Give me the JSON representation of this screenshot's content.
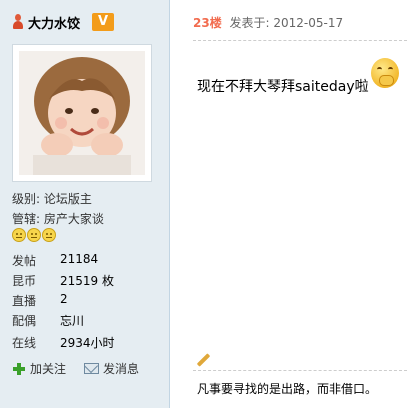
{
  "author": {
    "name": "大力水饺",
    "badge": "V"
  },
  "profile": {
    "rank_label": "级别:",
    "rank_value": "论坛版主",
    "title_label": "管辖:",
    "title_value": "房产大家谈",
    "stars": 3,
    "stats": [
      {
        "label": "发帖",
        "value": "21184"
      },
      {
        "label": "昆币",
        "value": "21519 枚"
      },
      {
        "label": "直播",
        "value": "2"
      },
      {
        "label": "配偶",
        "value": "忘川"
      },
      {
        "label": "在线",
        "value": "2934小时"
      }
    ]
  },
  "actions": {
    "follow": "加关注",
    "message": "发消息"
  },
  "post": {
    "floor": "23楼",
    "posted_at": "发表于: 2012-05-17",
    "content": "现在不拜大琴拜saiteday啦",
    "signature": "凡事要寻找的是出路，而非借口。"
  }
}
